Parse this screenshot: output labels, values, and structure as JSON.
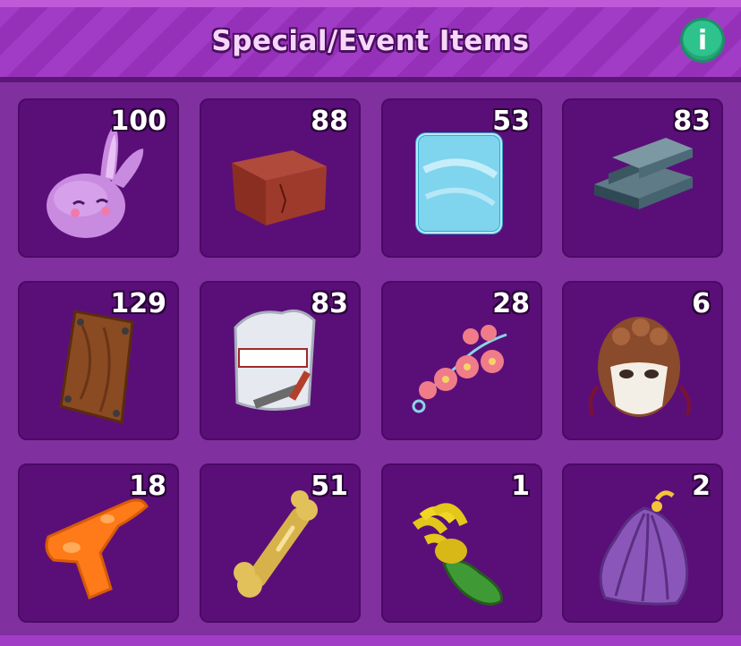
{
  "header": {
    "title": "Special/Event Items",
    "info_label": "i"
  },
  "items": [
    {
      "name": "bunny-potion",
      "count": "100"
    },
    {
      "name": "brick",
      "count": "88"
    },
    {
      "name": "glass-panel",
      "count": "53"
    },
    {
      "name": "steel-beam",
      "count": "83"
    },
    {
      "name": "wood-plank",
      "count": "129"
    },
    {
      "name": "cement-bag",
      "count": "83"
    },
    {
      "name": "pearl-beads",
      "count": "28"
    },
    {
      "name": "venetian-mask",
      "count": "6"
    },
    {
      "name": "water-gun",
      "count": "18"
    },
    {
      "name": "golden-bone",
      "count": "51"
    },
    {
      "name": "pickle-flower",
      "count": "1"
    },
    {
      "name": "seashell-cape",
      "count": "2"
    }
  ]
}
